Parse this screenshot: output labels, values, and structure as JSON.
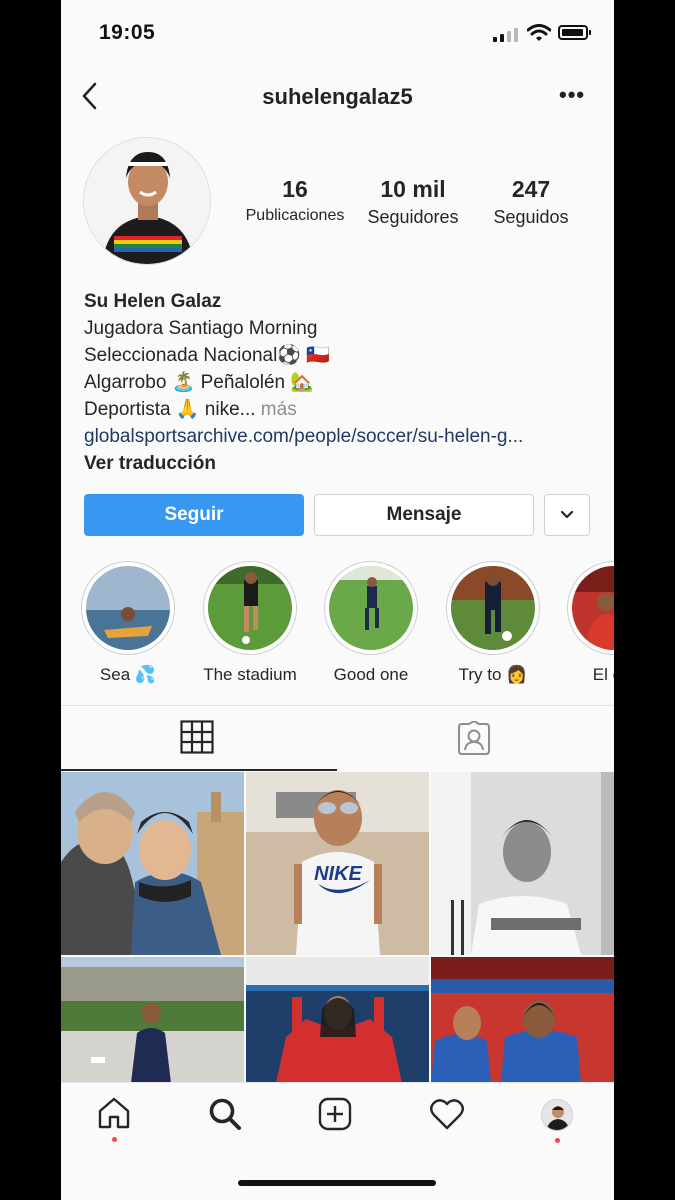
{
  "status_bar": {
    "time": "19:05"
  },
  "header": {
    "username": "suhelengalaz5",
    "more_label": "•••"
  },
  "profile": {
    "stats": [
      {
        "value": "16",
        "label": "Publicaciones"
      },
      {
        "value": "10 mil",
        "label": "Seguidores"
      },
      {
        "value": "247",
        "label": "Seguidos"
      }
    ],
    "name": "Su Helen Galaz",
    "bio_lines": [
      "Jugadora Santiago Morning",
      "Seleccionada Nacional⚽ 🇨🇱",
      "Algarrobo 🏝️ Peñalolén 🏡"
    ],
    "bio_last": "Deportista 🙏 nike...",
    "bio_more": "más",
    "link": "globalsportsarchive.com/people/soccer/su-helen-g...",
    "translate": "Ver traducción"
  },
  "actions": {
    "follow": "Seguir",
    "message": "Mensaje"
  },
  "highlights": [
    {
      "label": "Sea 💦"
    },
    {
      "label": "The stadium"
    },
    {
      "label": "Good one"
    },
    {
      "label": "Try to 👩"
    },
    {
      "label": "El est"
    }
  ],
  "tabs": [
    {
      "icon": "grid-icon",
      "active": true
    },
    {
      "icon": "tagged-icon",
      "active": false
    }
  ],
  "posts": [
    {
      "icon": "photo"
    },
    {
      "icon": "photo"
    },
    {
      "icon": "photo"
    },
    {
      "icon": "photo"
    },
    {
      "icon": "photo"
    },
    {
      "icon": "photo"
    }
  ],
  "bottom_nav": [
    "home-icon",
    "search-icon",
    "add-post-icon",
    "activity-icon",
    "profile-icon"
  ],
  "colors": {
    "follow": "#3897f0",
    "notification_dot": "#ed4956",
    "link": "#1f3a64"
  }
}
